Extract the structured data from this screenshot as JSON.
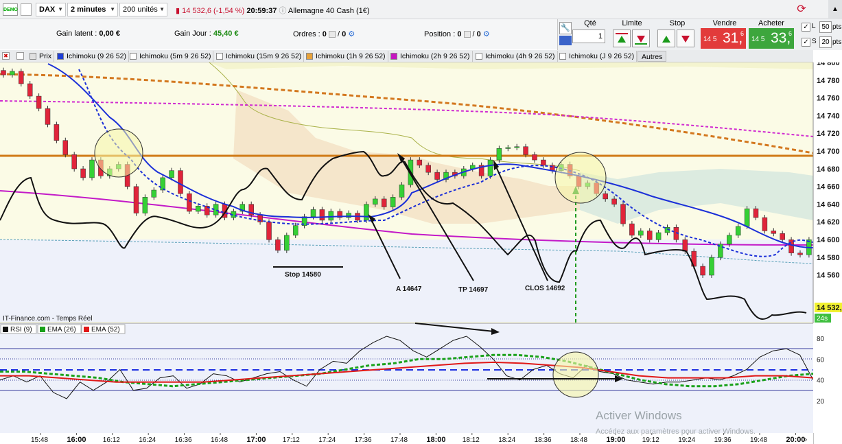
{
  "toolbar": {
    "demo_label": "DEMO",
    "instrument": "DAX",
    "timeframe": "2 minutes",
    "units": "200 unités",
    "last_price": "14 532,6",
    "change": "(-1,54 %)",
    "time": "20:59:37",
    "market_name": "Allemagne 40 Cash (1€)"
  },
  "stats": {
    "gain_latent_label": "Gain latent :",
    "gain_latent_value": "0,00 €",
    "gain_jour_label": "Gain Jour :",
    "gain_jour_value": "45,40 €",
    "ordres_label": "Ordres :",
    "ordres_count": "0",
    "ordres_pending": "0",
    "position_label": "Position :",
    "position_count": "0",
    "position_pending": "0"
  },
  "order_panel": {
    "qte_label": "Qté",
    "qte_value": "1",
    "limite_label": "Limite",
    "stop_label": "Stop",
    "vendre_label": "Vendre",
    "acheter_label": "Acheter",
    "sell_small": "14 5",
    "sell_big": "31,",
    "sell_sup": "6",
    "buy_small": "14 5",
    "buy_big": "33,",
    "buy_sup": "6",
    "l_label": "L",
    "l_value": "50",
    "s_label": "S",
    "s_value": "20",
    "pts_label": "pts"
  },
  "indicator_tabs": [
    {
      "label": "Prix",
      "color": "#e9eaec"
    },
    {
      "label": "Ichimoku (9 26 52)",
      "color": "#1f3fd6"
    },
    {
      "label": "Ichimoku (5m 9 26 52)",
      "color": "#ffffff"
    },
    {
      "label": "Ichimoku (15m 9 26 52)",
      "color": "#ffffff"
    },
    {
      "label": "Ichimoku (1h 9 26 52)",
      "color": "#e8a23a"
    },
    {
      "label": "Ichimoku (2h 9 26 52)",
      "color": "#c616c0"
    },
    {
      "label": "Ichimoku (4h 9 26 52)",
      "color": "#ffffff"
    },
    {
      "label": "Ichimoku (J 9 26 52)",
      "color": "#ffffff"
    }
  ],
  "autres_label": "Autres",
  "source_label": "IT-Finance.com - Temps Réel",
  "sub_legend": [
    {
      "label": "RSI (9)",
      "color": "#000000"
    },
    {
      "label": "EMA (26)",
      "color": "#1aa11a"
    },
    {
      "label": "EMA (52)",
      "color": "#e01818"
    }
  ],
  "annotations": {
    "stop": "Stop 14580",
    "a": "A 14647",
    "tp": "TP 14697",
    "clos": "CLOS 14692"
  },
  "price_tag": "14 532,",
  "countdown": "24s",
  "watermark_title": "Activer Windows",
  "watermark_sub": "Accédez aux paramètres pour activer Windows.",
  "chart_data": [
    {
      "type": "line",
      "title": "",
      "y_ticks": [
        "14 800",
        "14 780",
        "14 760",
        "14 740",
        "14 720",
        "14 700",
        "14 680",
        "14 660",
        "14 640",
        "14 620",
        "14 600",
        "14 580",
        "14 560"
      ],
      "ylim": [
        14547,
        14808
      ],
      "x_ticks": [
        "15:48",
        "16:00",
        "16:12",
        "16:24",
        "16:36",
        "16:48",
        "17:00",
        "17:12",
        "17:24",
        "17:36",
        "17:48",
        "18:00",
        "18:12",
        "18:24",
        "18:36",
        "18:48",
        "19:00",
        "19:12",
        "19:24",
        "19:36",
        "19:48",
        "20:00"
      ],
      "x_ticks_bold": [
        "16:00",
        "17:00",
        "18:00",
        "19:00",
        "20:00"
      ],
      "horizontal_line": 14700,
      "price_candles_approx": [
        [
          14791,
          14786
        ],
        [
          14786,
          14790
        ],
        [
          14790,
          14776
        ],
        [
          14776,
          14762
        ],
        [
          14762,
          14748
        ],
        [
          14748,
          14730
        ],
        [
          14730,
          14712
        ],
        [
          14712,
          14696
        ],
        [
          14696,
          14680
        ],
        [
          14680,
          14670
        ],
        [
          14670,
          14690
        ],
        [
          14690,
          14672
        ],
        [
          14672,
          14680
        ],
        [
          14680,
          14685
        ],
        [
          14685,
          14660
        ],
        [
          14660,
          14630
        ],
        [
          14630,
          14648
        ],
        [
          14648,
          14656
        ],
        [
          14656,
          14670
        ],
        [
          14670,
          14678
        ],
        [
          14678,
          14652
        ],
        [
          14652,
          14632
        ],
        [
          14632,
          14638
        ],
        [
          14638,
          14628
        ],
        [
          14628,
          14640
        ],
        [
          14640,
          14625
        ],
        [
          14625,
          14632
        ],
        [
          14632,
          14640
        ],
        [
          14640,
          14628
        ],
        [
          14628,
          14620
        ],
        [
          14620,
          14600
        ],
        [
          14600,
          14588
        ],
        [
          14588,
          14605
        ],
        [
          14605,
          14616
        ],
        [
          14616,
          14626
        ],
        [
          14626,
          14634
        ],
        [
          14634,
          14622
        ],
        [
          14622,
          14632
        ],
        [
          14632,
          14625
        ],
        [
          14625,
          14630
        ],
        [
          14630,
          14622
        ],
        [
          14622,
          14640
        ],
        [
          14640,
          14646
        ],
        [
          14646,
          14637
        ],
        [
          14637,
          14648
        ],
        [
          14648,
          14662
        ],
        [
          14662,
          14690
        ],
        [
          14690,
          14684
        ],
        [
          14684,
          14676
        ],
        [
          14676,
          14668
        ],
        [
          14668,
          14676
        ],
        [
          14676,
          14672
        ],
        [
          14672,
          14680
        ],
        [
          14680,
          14684
        ],
        [
          14684,
          14672
        ],
        [
          14672,
          14690
        ],
        [
          14690,
          14703
        ],
        [
          14703,
          14704
        ],
        [
          14704,
          14705
        ],
        [
          14705,
          14696
        ],
        [
          14696,
          14690
        ],
        [
          14690,
          14684
        ],
        [
          14684,
          14678
        ],
        [
          14678,
          14685
        ],
        [
          14685,
          14672
        ],
        [
          14672,
          14660
        ],
        [
          14660,
          14664
        ],
        [
          14664,
          14652
        ],
        [
          14652,
          14646
        ],
        [
          14646,
          14640
        ],
        [
          14640,
          14618
        ],
        [
          14618,
          14605
        ],
        [
          14605,
          14610
        ],
        [
          14610,
          14600
        ],
        [
          14600,
          14608
        ],
        [
          14608,
          14614
        ],
        [
          14614,
          14600
        ],
        [
          14600,
          14587
        ],
        [
          14587,
          14570
        ],
        [
          14570,
          14560
        ],
        [
          14560,
          14580
        ],
        [
          14580,
          14595
        ],
        [
          14595,
          14605
        ],
        [
          14605,
          14615
        ],
        [
          14615,
          14635
        ],
        [
          14635,
          14625
        ],
        [
          14625,
          14610
        ],
        [
          14610,
          14607
        ],
        [
          14607,
          14600
        ],
        [
          14600,
          14585
        ],
        [
          14585,
          14583
        ],
        [
          14583,
          14600
        ]
      ]
    },
    {
      "type": "line",
      "title": "",
      "y_ticks": [
        "80",
        "60",
        "40",
        "20"
      ],
      "ylim": [
        0,
        90
      ],
      "series": [
        {
          "name": "RSI (9)",
          "values": [
            40,
            44,
            38,
            44,
            28,
            22,
            38,
            30,
            38,
            50,
            30,
            32,
            42,
            44,
            32,
            36,
            46,
            44,
            38,
            42,
            46,
            48,
            40,
            34,
            50,
            58,
            56,
            68,
            76,
            82,
            78,
            68,
            62,
            70,
            78,
            82,
            72,
            60,
            44,
            40,
            50,
            54,
            46,
            42,
            54,
            48,
            46,
            40,
            38,
            36,
            38,
            38,
            40,
            42,
            40,
            44,
            50,
            62,
            68,
            70,
            64,
            40
          ]
        },
        {
          "name": "EMA (26)",
          "values": [
            48,
            48,
            46,
            44,
            42,
            38,
            36,
            34,
            36,
            38,
            40,
            42,
            44,
            46,
            50,
            54,
            56,
            60,
            60,
            62,
            64,
            64,
            62,
            58,
            52,
            46,
            40,
            36,
            34,
            34,
            36,
            40,
            44,
            46
          ]
        },
        {
          "name": "EMA (52)",
          "values": [
            44,
            44,
            42,
            40,
            38,
            38,
            38,
            38,
            40,
            42,
            44,
            46,
            48,
            50,
            52,
            54,
            56,
            57,
            56,
            54,
            52,
            48,
            44,
            42,
            42,
            42,
            44,
            44,
            42
          ]
        }
      ]
    }
  ]
}
